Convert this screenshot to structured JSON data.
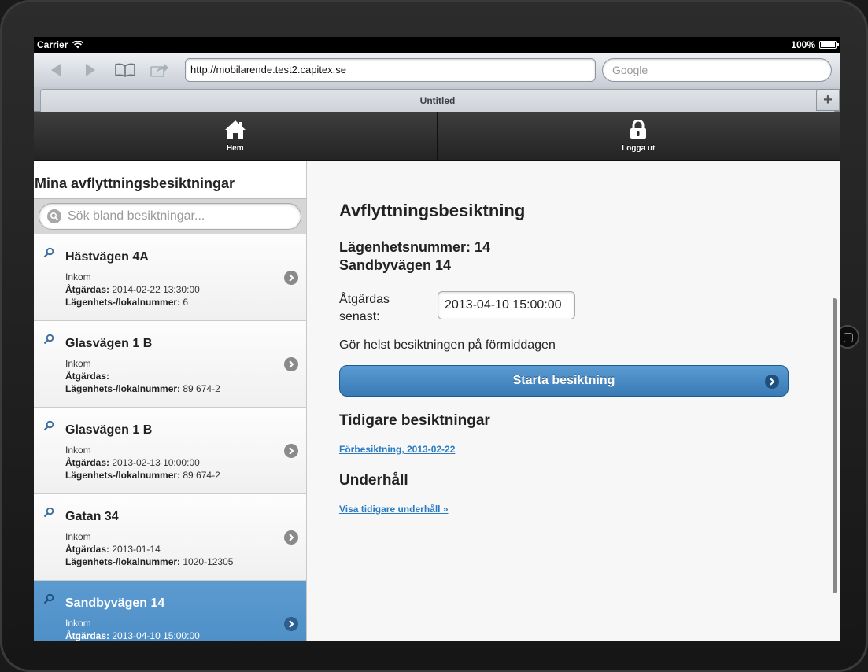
{
  "statusbar": {
    "carrier": "Carrier",
    "battery": "100%"
  },
  "browser": {
    "url": "http://mobilarende.test2.capitex.se",
    "search_placeholder": "Google",
    "tab_title": "Untitled",
    "new_tab_label": "+"
  },
  "nav": {
    "home_label": "Hem",
    "logout_label": "Logga ut"
  },
  "sidebar": {
    "title": "Mina avflyttningsbesiktningar",
    "search_placeholder": "Sök bland besiktningar...",
    "items": [
      {
        "title": "Hästvägen 4A",
        "status": "Inkom",
        "due_label": "Åtgärdas:",
        "due": "2014-02-22 13:30:00",
        "unit_label": "Lägenhets-/lokalnummer:",
        "unit": "6",
        "active": false
      },
      {
        "title": "Glasvägen 1 B",
        "status": "Inkom",
        "due_label": "Åtgärdas:",
        "due": "",
        "unit_label": "Lägenhets-/lokalnummer:",
        "unit": "89 674-2",
        "active": false
      },
      {
        "title": "Glasvägen 1 B",
        "status": "Inkom",
        "due_label": "Åtgärdas:",
        "due": "2013-02-13 10:00:00",
        "unit_label": "Lägenhets-/lokalnummer:",
        "unit": "89 674-2",
        "active": false
      },
      {
        "title": "Gatan 34",
        "status": "Inkom",
        "due_label": "Åtgärdas:",
        "due": "2013-01-14",
        "unit_label": "Lägenhets-/lokalnummer:",
        "unit": "1020-12305",
        "active": false
      },
      {
        "title": "Sandbyvägen 14",
        "status": "Inkom",
        "due_label": "Åtgärdas:",
        "due": "2013-04-10 15:00:00",
        "unit_label": "",
        "unit": "",
        "active": true
      }
    ]
  },
  "main": {
    "heading": "Avflyttningsbesiktning",
    "apartment_line": "Lägenhetsnummer: 14",
    "address_line": "Sandbyvägen 14",
    "due_label_line1": "Åtgärdas",
    "due_label_line2": "senast:",
    "due_value": "2013-04-10 15:00:00",
    "note": "Gör helst besiktningen på förmiddagen",
    "start_button": "Starta besiktning",
    "previous_heading": "Tidigare besiktningar",
    "previous_link": "Förbesiktning, 2013-02-22",
    "maintenance_heading": "Underhåll",
    "maintenance_link": "Visa tidigare underhåll »"
  },
  "colors": {
    "accent": "#4a8bc4",
    "header_dark": "#2a2a2a",
    "link": "#2a7bc0"
  }
}
